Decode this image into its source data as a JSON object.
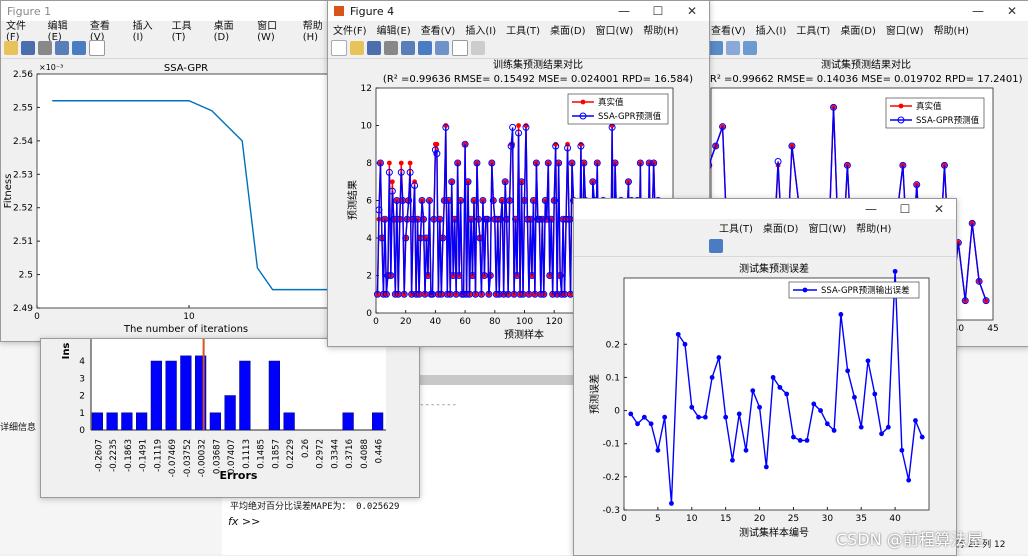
{
  "fig1": {
    "title": "Figure 1",
    "menu": [
      "文件(F)",
      "编辑(E)",
      "查看(V)",
      "插入(I)",
      "工具(T)",
      "桌面(D)",
      "窗口(W)",
      "帮助(H)"
    ],
    "chart_data": {
      "type": "line",
      "title": "SSA-GPR",
      "xlabel": "The number of iterations",
      "ylabel": "Fitness",
      "exponent_label": "×10⁻³",
      "xlim": [
        0,
        20
      ],
      "ylim": [
        2.49,
        2.56
      ],
      "xticks": [
        0,
        10
      ],
      "yticks": [
        2.49,
        2.5,
        2.51,
        2.52,
        2.53,
        2.54,
        2.55,
        2.56
      ],
      "ytick_labels": [
        "2.49",
        "2.5",
        "2.51",
        "2.52",
        "2.53",
        "2.54",
        "2.55",
        "2.56"
      ],
      "x": [
        1,
        10,
        11.5,
        13.5,
        14.5,
        15.5,
        20
      ],
      "y": [
        2.552,
        2.552,
        2.549,
        2.54,
        2.502,
        2.4955,
        2.4955
      ]
    }
  },
  "histogram": {
    "chart_data": {
      "type": "bar",
      "xlabel": "Errors",
      "ylabel_fragment": "Ins",
      "yticks": [
        0,
        1,
        2,
        3,
        4
      ],
      "categories": [
        "-0.2607",
        "-0.2235",
        "-0.1863",
        "-0.1491",
        "-0.1119",
        "-0.07469",
        "-0.03752",
        "-0.00032",
        "0.03687",
        "0.07407",
        "0.1113",
        "0.1485",
        "0.1857",
        "0.2229",
        "0.26",
        "0.2972",
        "0.3344",
        "0.3716",
        "0.4088",
        "0.446"
      ],
      "values": [
        1,
        1,
        1,
        1,
        4,
        4,
        6,
        6,
        1,
        2,
        4,
        0,
        4,
        1,
        0,
        0,
        0,
        1,
        0,
        1
      ],
      "fit_line_color": "#d9541a"
    }
  },
  "fig4": {
    "title": "Figure 4",
    "menu": [
      "文件(F)",
      "编辑(E)",
      "查看(V)",
      "插入(I)",
      "工具(T)",
      "桌面(D)",
      "窗口(W)",
      "帮助(H)"
    ],
    "chart_data": {
      "type": "line",
      "title": "训练集预测结果对比",
      "subtitle": "(R² =0.99636 RMSE= 0.15492 MSE= 0.024001 RPD= 16.584)",
      "xlabel": "预测样本",
      "ylabel": "预测结果",
      "xlim": [
        0,
        200
      ],
      "ylim": [
        0,
        12
      ],
      "xticks": [
        0,
        20,
        40,
        60,
        80,
        100,
        120,
        140,
        160,
        180,
        200
      ],
      "yticks": [
        0,
        2,
        4,
        6,
        8,
        10,
        12
      ],
      "legend": [
        "真实值",
        "SSA-GPR预测值"
      ],
      "legend_position": "top-right",
      "series": [
        {
          "name": "真实值",
          "color": "#ff0000",
          "values": [
            1,
            5,
            8,
            4,
            1,
            5,
            1,
            2,
            8,
            2,
            7,
            5,
            1,
            6,
            1,
            5,
            8,
            6,
            1,
            4,
            5,
            6,
            8,
            1,
            5,
            7,
            1,
            5,
            1,
            4,
            6,
            5,
            1,
            4,
            2,
            6,
            1,
            1,
            5,
            9,
            9,
            1,
            5,
            1,
            4,
            6,
            10,
            1,
            6,
            1,
            7,
            2,
            5,
            1,
            8,
            2,
            6,
            1,
            1,
            9,
            1,
            7,
            1,
            5,
            2,
            6,
            1,
            8,
            5,
            4,
            1,
            6,
            2,
            5,
            5,
            1,
            2,
            8,
            6,
            5,
            1,
            5,
            1,
            5,
            6,
            1,
            7,
            5,
            1,
            6,
            9,
            9,
            1,
            5,
            2,
            10,
            1,
            7,
            1,
            6,
            10,
            5,
            1,
            5,
            2,
            6,
            1,
            8,
            5,
            5,
            1,
            5,
            1,
            6,
            5,
            8,
            2,
            5,
            1,
            6,
            9,
            1,
            8,
            2,
            1,
            5,
            1,
            5,
            9,
            5,
            1,
            8,
            6,
            5,
            1,
            5,
            2,
            9,
            1,
            8,
            6,
            2,
            1,
            5,
            1,
            7,
            6,
            4,
            8,
            1,
            5,
            2,
            6,
            1,
            5,
            2,
            5,
            1,
            10,
            1,
            8,
            5,
            5,
            2,
            6,
            1,
            5,
            2,
            5,
            7,
            1,
            6,
            1,
            5,
            2,
            6,
            1,
            8,
            1,
            5,
            2,
            5,
            1,
            8,
            2,
            5,
            8,
            5,
            2,
            6
          ]
        },
        {
          "name": "SSA-GPR预测值",
          "color": "#0000ff",
          "values": [
            1,
            5.5,
            8,
            4,
            1,
            5,
            1,
            2,
            7.5,
            2,
            6.5,
            5,
            1,
            6,
            1,
            5,
            7.5,
            6,
            1,
            4,
            5,
            6,
            7.5,
            1,
            5,
            6.8,
            1,
            5,
            1,
            4,
            6,
            5,
            1,
            4,
            2,
            6,
            1,
            1,
            5,
            8.7,
            8.5,
            1,
            5,
            1,
            4,
            6,
            9.9,
            1,
            6,
            1,
            7,
            2,
            5,
            1,
            8,
            2,
            6,
            1,
            1,
            9,
            1,
            7,
            1,
            5,
            2,
            6,
            1,
            8,
            5,
            4,
            1,
            6,
            2,
            5,
            5,
            1,
            2,
            8,
            6,
            5,
            1,
            5,
            1,
            5,
            6,
            1,
            7,
            5,
            1,
            6,
            8.9,
            9.9,
            1,
            5,
            2,
            9.6,
            1,
            7,
            1,
            6,
            9.9,
            5,
            1,
            5,
            2,
            6,
            1,
            8,
            5,
            5,
            1,
            5,
            1,
            6,
            5,
            8,
            2,
            5,
            1,
            6,
            8.9,
            1,
            8,
            2,
            1,
            5,
            1,
            5,
            8.8,
            5,
            1,
            8,
            6,
            5,
            1,
            5,
            2,
            8.9,
            1,
            8,
            6,
            2,
            1,
            5,
            1,
            7,
            6,
            4,
            8,
            1,
            5,
            2,
            6,
            1,
            5,
            2,
            5,
            1,
            9.9,
            1,
            8,
            5,
            5,
            2,
            6,
            1,
            5,
            2,
            5,
            7,
            1,
            6,
            1,
            5,
            2,
            6,
            1,
            8,
            1,
            5,
            2,
            5,
            1,
            8,
            2,
            5,
            8,
            5,
            2,
            6
          ]
        }
      ]
    }
  },
  "fig_back": {
    "menu": [
      "查看(V)",
      "插入(I)",
      "工具(T)",
      "桌面(D)",
      "窗口(W)",
      "帮助(H)"
    ],
    "chart_data": {
      "type": "line",
      "title": "测试集预测结果对比",
      "subtitle": "(R² =0.99662 RMSE= 0.14036 MSE= 0.019702 RPD= 17.2401)",
      "xlim": [
        0,
        45
      ],
      "xticks": [
        40,
        45
      ],
      "legend": [
        "真实值",
        "SSA-GPR预测值"
      ],
      "legend_position": "top-right",
      "series": [
        {
          "name": "真实值",
          "color": "#ff0000",
          "values": [
            1,
            4,
            5,
            8,
            9,
            10,
            1,
            5,
            1,
            2,
            1,
            6,
            1,
            8,
            1,
            9,
            6,
            5,
            1,
            4,
            1,
            11,
            1,
            8,
            1,
            5,
            2,
            1,
            4,
            1,
            5,
            8,
            1,
            7,
            1,
            4,
            1,
            8,
            1,
            4,
            1,
            5,
            2,
            1
          ]
        },
        {
          "name": "SSA-GPR预测值",
          "color": "#0000ff",
          "values": [
            1,
            4,
            5,
            8,
            9,
            10,
            1,
            5,
            1,
            2,
            1,
            6,
            1,
            8.2,
            1,
            9,
            6,
            5,
            1,
            4,
            1,
            11,
            1,
            8,
            1,
            5,
            2,
            1,
            4,
            1,
            5,
            8,
            1,
            7,
            1,
            4,
            1,
            8,
            1,
            4,
            1,
            5,
            2,
            1
          ]
        }
      ]
    }
  },
  "fig_err": {
    "menu": [
      "工具(T)",
      "桌面(D)",
      "窗口(W)",
      "帮助(H)"
    ],
    "chart_data": {
      "type": "line",
      "title": "测试集预测误差",
      "xlabel": "测试集样本编号",
      "ylabel": "预测误差",
      "xlim": [
        0,
        45
      ],
      "ylim": [
        -0.3,
        0.4
      ],
      "xticks": [
        0,
        5,
        10,
        15,
        20,
        25,
        30,
        35,
        40
      ],
      "yticks": [
        -0.3,
        -0.2,
        -0.1,
        0,
        0.1,
        0.2
      ],
      "legend": [
        "SSA-GPR预测输出误差"
      ],
      "legend_position": "top-right",
      "series": [
        {
          "name": "SSA-GPR预测输出误差",
          "color": "#0000ff",
          "values": [
            -0.01,
            -0.04,
            -0.02,
            -0.04,
            -0.12,
            -0.02,
            -0.28,
            0.23,
            0.2,
            0.01,
            -0.02,
            -0.02,
            0.1,
            0.16,
            -0.02,
            -0.15,
            -0.01,
            -0.12,
            0.06,
            0.01,
            -0.17,
            0.1,
            0.07,
            0.05,
            -0.08,
            -0.09,
            -0.09,
            0.02,
            0.0,
            -0.04,
            -0.06,
            0.29,
            0.12,
            0.04,
            -0.05,
            0.15,
            0.05,
            -0.07,
            -0.05,
            0.42,
            -0.12,
            -0.21,
            -0.03,
            -0.08
          ]
        }
      ]
    }
  },
  "console": {
    "detail_label": "详细信息",
    "mape_line": "平均绝对百分比误差MAPE为： 0.025629",
    "prompt": "fx >>",
    "dashes": "-------------------------------------------",
    "status_text": "行 26 列 12"
  },
  "watermark": "CSDN @前程算法屋",
  "colors": {
    "red": "#ff0000",
    "blue": "#0000ff",
    "axis": "#262626",
    "grid": "#e6e6e6"
  }
}
